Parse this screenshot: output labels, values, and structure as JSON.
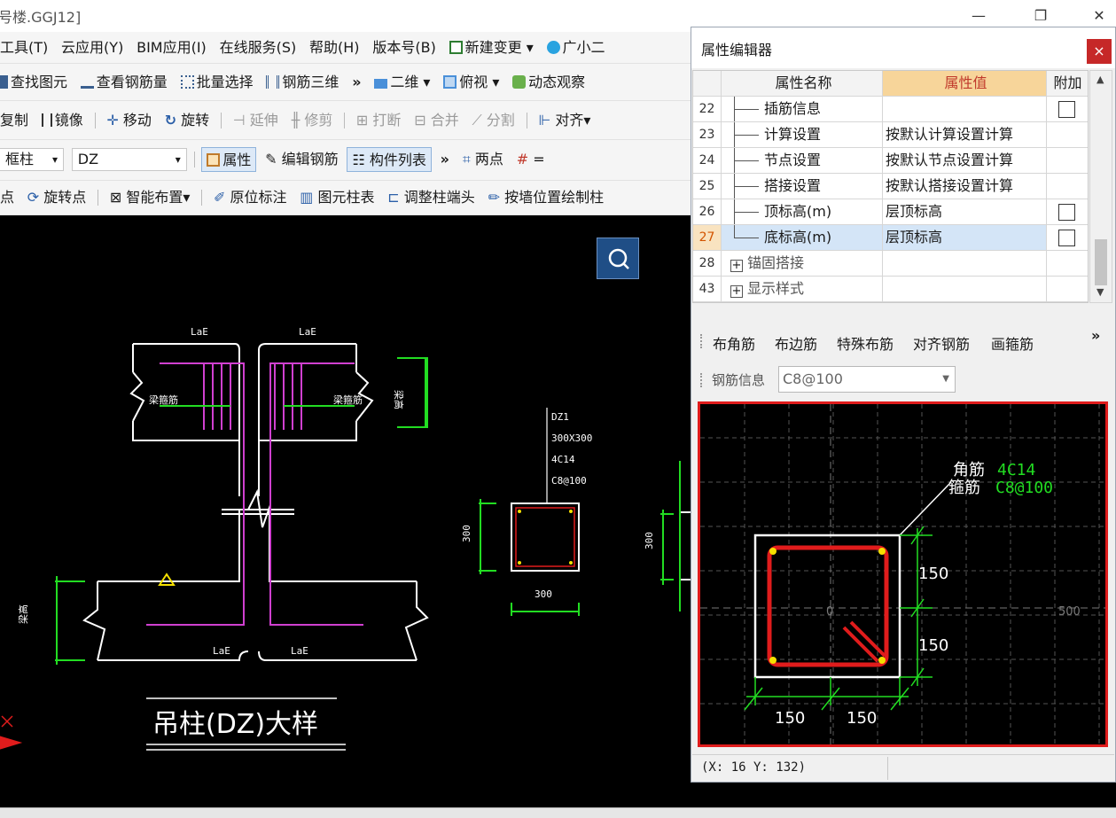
{
  "window": {
    "title": "号楼.GGJ12]",
    "controls": [
      "minimize-icon",
      "restore-icon",
      "close-icon"
    ]
  },
  "menu": [
    "工具(T)",
    "云应用(Y)",
    "BIM应用(I)",
    "在线服务(S)",
    "帮助(H)",
    "版本号(B)",
    "新建变更",
    "广小二"
  ],
  "toolbar1": {
    "find": "查找图元",
    "view_rebar": "查看钢筋量",
    "batch": "批量选择",
    "rebar3d": "钢筋三维",
    "more": "»",
    "dim": "二维",
    "view": "俯视",
    "dynamic": "动态观察"
  },
  "toolbar2": {
    "copy": "复制",
    "mirror": "镜像",
    "move": "移动",
    "rotate": "旋转",
    "extend": "延伸",
    "trim": "修剪",
    "break": "打断",
    "merge": "合并",
    "split": "分割",
    "align": "对齐"
  },
  "toolbar3": {
    "type_value": "框柱",
    "name_value": "DZ",
    "prop": "属性",
    "edit_rebar": "编辑钢筋",
    "comp_list": "构件列表",
    "more": "»",
    "twopoint": "两点",
    "cut": "="
  },
  "toolbar4": {
    "point": "点",
    "rotpoint": "旋转点",
    "smart": "智能布置",
    "inplace": "原位标注",
    "coltable": "图元柱表",
    "adjust": "调整柱端头",
    "wallpos": "按墙位置绘制柱"
  },
  "cad": {
    "title": "吊柱(DZ)大样",
    "lae": "LaE",
    "beam_stirrup": "梁箍筋",
    "beam_height": "梁高",
    "dz_label": [
      "DZ1",
      "300X300",
      "4C14",
      "C8@100"
    ],
    "dim300": "300"
  },
  "panel": {
    "title": "属性编辑器",
    "close": "×",
    "headers": {
      "name": "属性名称",
      "value": "属性值",
      "extra": "附加"
    },
    "rows": [
      {
        "no": "22",
        "name": "插筋信息",
        "value": "",
        "check": true,
        "kind": "child"
      },
      {
        "no": "23",
        "name": "计算设置",
        "value": "按默认计算设置计算",
        "check": false,
        "kind": "child"
      },
      {
        "no": "24",
        "name": "节点设置",
        "value": "按默认节点设置计算",
        "check": false,
        "kind": "child"
      },
      {
        "no": "25",
        "name": "搭接设置",
        "value": "按默认搭接设置计算",
        "check": false,
        "kind": "child"
      },
      {
        "no": "26",
        "name": "顶标高(m)",
        "value": "层顶标高",
        "check": true,
        "kind": "child"
      },
      {
        "no": "27",
        "name": "底标高(m)",
        "value": "层顶标高",
        "check": true,
        "kind": "last",
        "selected": true
      },
      {
        "no": "28",
        "name": "锚固搭接",
        "value": "",
        "check": false,
        "kind": "group"
      },
      {
        "no": "43",
        "name": "显示样式",
        "value": "",
        "check": false,
        "kind": "group"
      }
    ],
    "rebar_tools": [
      "布角筋",
      "布边筋",
      "特殊布筋",
      "对齐钢筋",
      "画箍筋"
    ],
    "rebar_more": "»",
    "rebar_info_label": "钢筋信息",
    "rebar_info_value": "C8@100",
    "section": {
      "corner_label": "角筋",
      "corner_value": "4C14",
      "stirrup_label": "箍筋",
      "stirrup_value": "C8@100",
      "dim_150": "150",
      "axis_0": "0",
      "axis_500": "500"
    },
    "status_coord": "(X: 16 Y: 132)"
  },
  "colors": {
    "selection": "#d4e5f7",
    "header_value": "#f7d59a",
    "rebar_red": "#e01c1c",
    "cad_green": "#22dd22",
    "cad_magenta": "#d040d0"
  }
}
